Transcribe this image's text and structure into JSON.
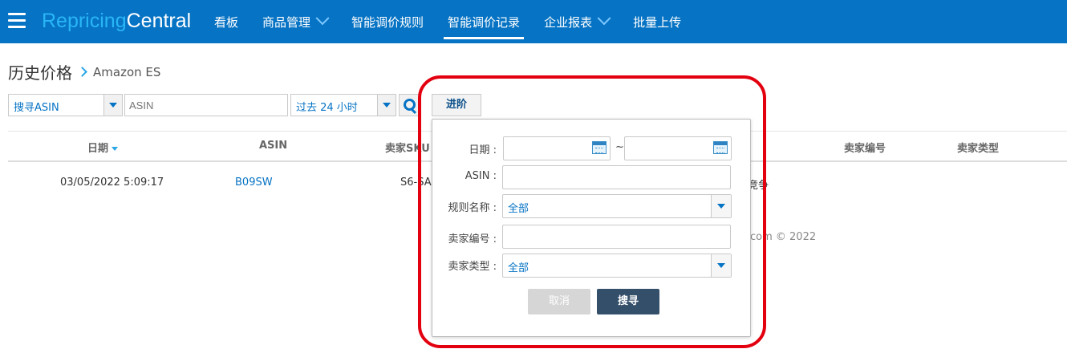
{
  "header": {
    "logo_part1": "Repricing",
    "logo_part2": "Central",
    "nav": [
      {
        "label": "看板"
      },
      {
        "label": "商品管理"
      },
      {
        "label": "智能调价规则"
      },
      {
        "label": "智能调价记录"
      },
      {
        "label": "企业报表"
      },
      {
        "label": "批量上传"
      }
    ]
  },
  "breadcrumb": {
    "title": "历史价格",
    "sub": "Amazon ES"
  },
  "filters": {
    "search_type": "搜寻ASIN",
    "asin_placeholder": "ASIN",
    "time_range": "过去 24 小时",
    "advanced_label": "进阶"
  },
  "table": {
    "headers": [
      "日期",
      "ASIN",
      "卖家SKU",
      "卖家编号",
      "卖家类型"
    ],
    "row": {
      "date": "03/05/2022 5:09:17",
      "asin": "B09SW",
      "sku": "S6-SA",
      "partial": "竞争"
    }
  },
  "footer": "com © 2022",
  "popup": {
    "date_label": "日期 :",
    "tilde": "~",
    "asin_label": "ASIN :",
    "rule_label": "规则名称 :",
    "rule_value": "全部",
    "seller_id_label": "卖家编号 :",
    "seller_type_label": "卖家类型 :",
    "seller_type_value": "全部",
    "cancel": "取消",
    "search": "搜寻"
  },
  "colors": {
    "nav_bg": "#0673c4",
    "accent": "#29b6f6",
    "highlight": "#e3000f"
  }
}
